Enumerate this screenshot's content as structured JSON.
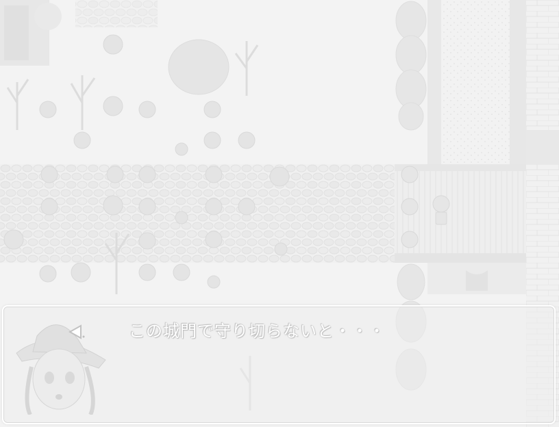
{
  "game": {
    "dialog": {
      "message": "この城門で守り切らないと・・・",
      "speaker_portrait": "witch-girl-portrait"
    },
    "map": {
      "scene": "town-gate-courtyard",
      "tint": "#f3f3f3"
    },
    "icons": {
      "message-cursor": "triangle-left-icon"
    }
  }
}
